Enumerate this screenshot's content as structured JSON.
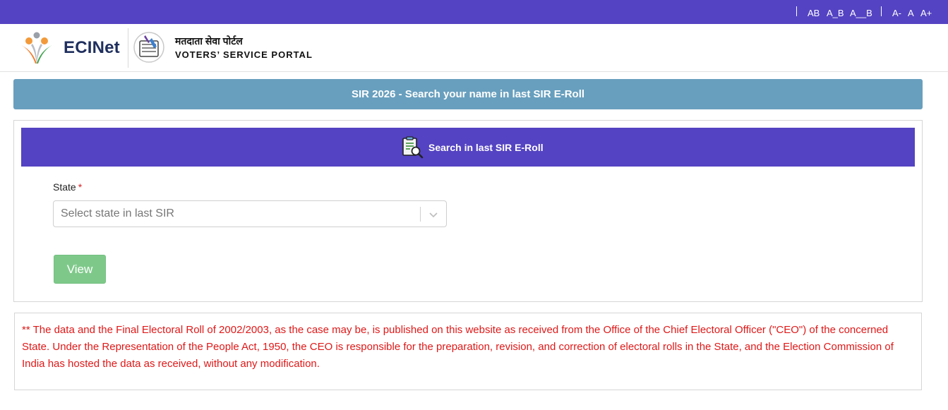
{
  "topbar": {
    "contrast_options": [
      "AB",
      "A_B",
      "A__B"
    ],
    "font_size_options": [
      "A-",
      "A",
      "A+"
    ],
    "color": "#5443c2"
  },
  "header": {
    "brand_name": "ECINet",
    "portal_hindi": "मतदाता सेवा पोर्टल",
    "portal_english": "VOTERS’ SERVICE PORTAL"
  },
  "banner": {
    "title": "SIR 2026 - Search your name in last SIR E-Roll",
    "color": "#689fbe"
  },
  "search_card": {
    "heading": "Search in last SIR E-Roll",
    "heading_icon": "document-search-icon",
    "state_label": "State",
    "required_mark": "*",
    "state_placeholder": "Select state in last SIR",
    "view_button": "View",
    "view_button_color": "#7ec98a"
  },
  "disclaimer": {
    "text": "** The data and the Final Electoral Roll of 2002/2003, as the case may be, is published on this website as received from the Office of the Chief Electoral Officer (\"CEO\") of the concerned State. Under the Representation of the People Act, 1950, the CEO is responsible for the preparation, revision, and correction of electoral rolls in the State, and the Election Commission of India has hosted the data as received, without any modification.",
    "color": "#e01818"
  }
}
